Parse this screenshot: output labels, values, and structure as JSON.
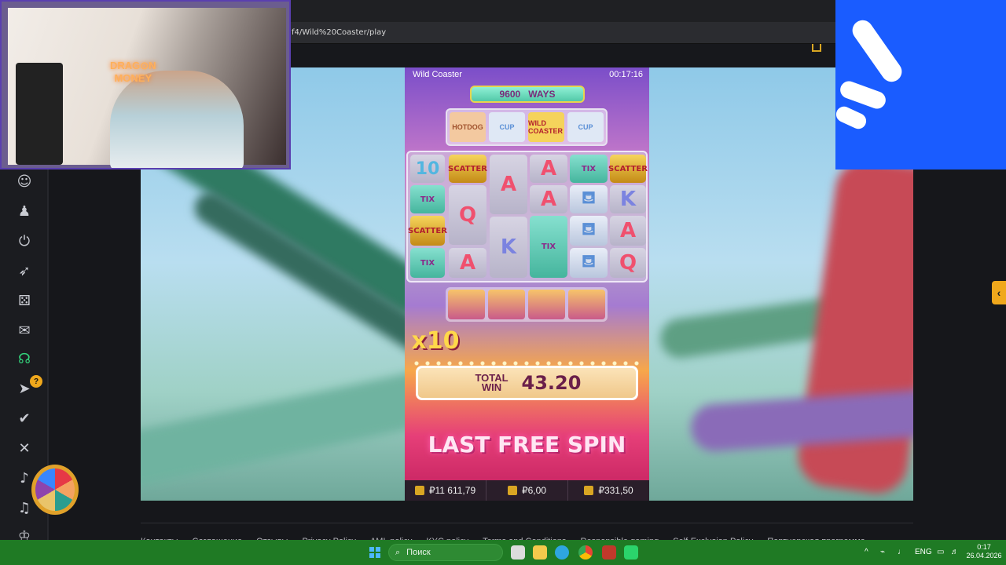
{
  "browser": {
    "url_fragment": "f4/Wild%20Coaster/play"
  },
  "webcam": {
    "neon_line1": "DRAG⊙N",
    "neon_line2": "MONEY"
  },
  "game": {
    "title": "Wild Coaster",
    "timer": "00:17:16",
    "ways_number": "9600",
    "ways_label": "WAYS",
    "top_reel": [
      "HOTDOG",
      "CUP",
      "WILD COASTER",
      "CUP"
    ],
    "grid_symbols": {
      "ten": "10",
      "scatter": "SCATTER",
      "a": "A",
      "q": "Q",
      "k": "K",
      "ticket": "TIX"
    },
    "multiplier": "x10",
    "total_win_label_1": "TOTAL",
    "total_win_label_2": "WIN",
    "total_win_value": "43.20",
    "banner": "LAST FREE SPIN",
    "balance": "₽11 611,79",
    "bet": "₽6,00",
    "win": "₽331,50"
  },
  "sidebar": {
    "badge": "?",
    "icons": [
      "robot-icon",
      "user-icon",
      "power-icon",
      "rocket-icon",
      "dice-icon",
      "gift-icon",
      "headset-icon",
      "telegram-icon",
      "vk-icon",
      "x-icon",
      "bell-icon",
      "sound-icon",
      "crown-icon"
    ]
  },
  "footer": {
    "links": [
      "Контакты",
      "Соглашение",
      "Отзывы",
      "Privacy Policy",
      "AML policy",
      "KYC policy",
      "Terms and Conditions",
      "Responsible gaming",
      "Self-Exclusion Policy",
      "Партнерская программа"
    ]
  },
  "taskbar": {
    "search_placeholder": "Поиск",
    "language": "ENG",
    "time": "0:17",
    "date": "26.04.2026"
  },
  "colors": {
    "taskbar": "#1f7a24",
    "accent": "#f0a81c",
    "overlay_blue": "#1a5cff"
  }
}
